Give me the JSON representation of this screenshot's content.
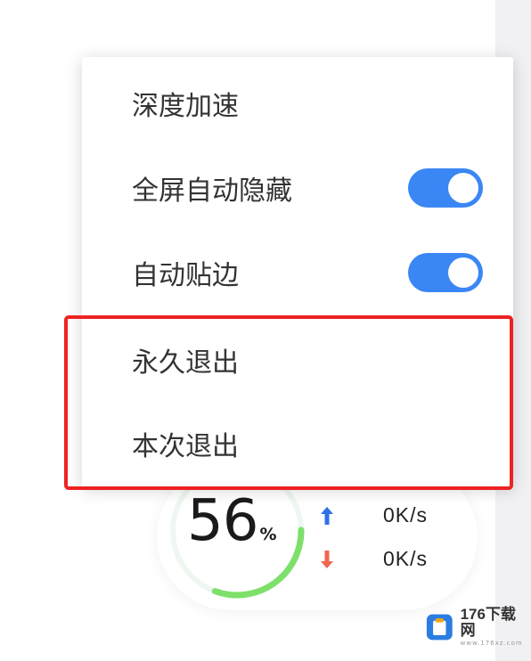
{
  "menu": {
    "items": [
      {
        "label": "深度加速",
        "has_toggle": false
      },
      {
        "label": "全屏自动隐藏",
        "has_toggle": true,
        "toggle_on": true
      },
      {
        "label": "自动贴边",
        "has_toggle": true,
        "toggle_on": true
      },
      {
        "label": "永久退出",
        "has_toggle": false
      },
      {
        "label": "本次退出",
        "has_toggle": false
      }
    ]
  },
  "widget": {
    "usage_value": "56",
    "usage_unit": "%",
    "usage_fraction": 0.56,
    "upload_speed": "0K/s",
    "download_speed": "0K/s"
  },
  "colors": {
    "accent_blue": "#3b86f5",
    "highlight_red": "#ee2222",
    "gauge_green": "#7ee06a",
    "arrow_up": "#2f6fe8",
    "arrow_down": "#f0664f"
  },
  "icons": {
    "upload": "arrow-up-icon",
    "download": "arrow-down-icon"
  },
  "watermark": {
    "title": "176下载网",
    "subtitle": "www.176xz.com"
  }
}
